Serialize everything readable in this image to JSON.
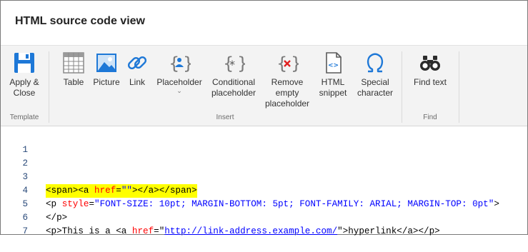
{
  "window": {
    "title": "HTML source code view"
  },
  "ribbon": {
    "groups": {
      "template": {
        "label": "Template"
      },
      "insert": {
        "label": "Insert"
      },
      "find": {
        "label": "Find"
      }
    },
    "tools": {
      "apply_close": {
        "label": "Apply &\nClose",
        "icon": "save-icon"
      },
      "table": {
        "label": "Table",
        "icon": "table-icon"
      },
      "picture": {
        "label": "Picture",
        "icon": "picture-icon"
      },
      "link": {
        "label": "Link",
        "icon": "link-icon"
      },
      "placeholder": {
        "label": "Placeholder",
        "icon": "placeholder-icon"
      },
      "conditional_placeholder": {
        "label": "Conditional\nplaceholder",
        "icon": "conditional-placeholder-icon"
      },
      "remove_empty_placeholder": {
        "label": "Remove\nempty\nplaceholder",
        "icon": "remove-placeholder-icon"
      },
      "html_snippet": {
        "label": "HTML\nsnippet",
        "icon": "html-snippet-icon"
      },
      "special_character": {
        "label": "Special\ncharacter",
        "icon": "omega-icon"
      },
      "find_text": {
        "label": "Find text",
        "icon": "binoculars-icon"
      }
    },
    "colors": {
      "accent": "#1e78d7",
      "remove_red": "#e02020"
    }
  },
  "editor": {
    "line_numbers": [
      "1",
      "2",
      "3",
      "4",
      "5",
      "6",
      "7"
    ],
    "line3": {
      "t1": "<span><a ",
      "a1": "href",
      "t2": "=",
      "s1": "\"\"",
      "t3": "></a></span>"
    },
    "line4": {
      "t1": "<p ",
      "a1": "style",
      "t2": "=",
      "s1": "\"FONT-SIZE: 10pt; MARGIN-BOTTOM: 5pt; FONT-FAMILY: ARIAL; MARGIN-TOP: 0pt\"",
      "t3": ">"
    },
    "line5": {
      "t1": "</p>"
    },
    "line6": {
      "t1": "<p>This is a <a ",
      "a1": "href",
      "t2": "=\"",
      "link": "http://link-address.example.com/",
      "t3": "\">hyperlink</a></p>"
    }
  }
}
